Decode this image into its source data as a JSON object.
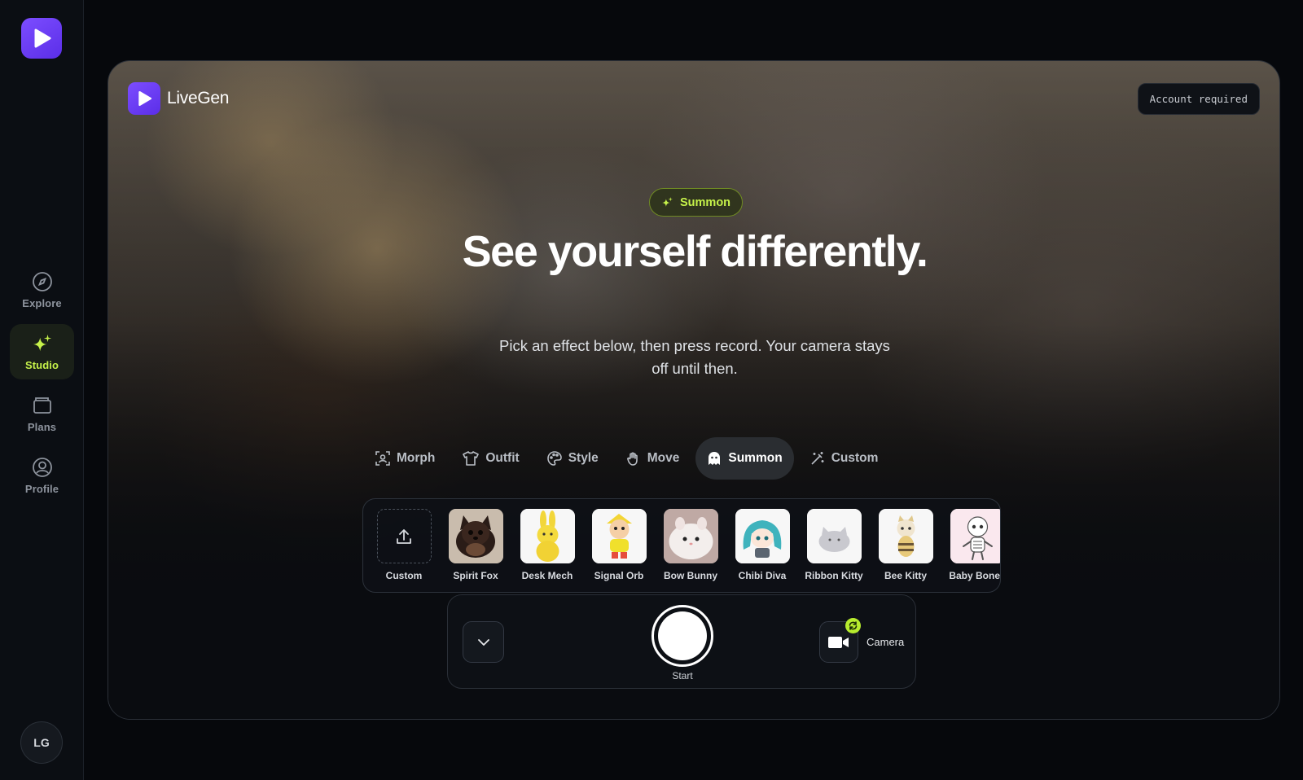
{
  "sidebar": {
    "logo_icon": "play-icon",
    "items": [
      {
        "label": "Explore",
        "icon": "compass-icon",
        "active": false
      },
      {
        "label": "Studio",
        "icon": "sparkle-icon",
        "active": true
      },
      {
        "label": "Plans",
        "icon": "wallet-icon",
        "active": false
      },
      {
        "label": "Profile",
        "icon": "user-circle-icon",
        "active": false
      }
    ],
    "avatar_initials": "LG"
  },
  "stage": {
    "brand": "LiveGen",
    "account_button": "Account required",
    "badge": "Summon",
    "headline": "See yourself differently.",
    "subline": "Pick an effect below, then press record. Your camera stays off until then."
  },
  "tabs": [
    {
      "label": "Morph",
      "icon": "face-scan-icon"
    },
    {
      "label": "Outfit",
      "icon": "shirt-icon"
    },
    {
      "label": "Style",
      "icon": "palette-icon"
    },
    {
      "label": "Move",
      "icon": "hand-icon"
    },
    {
      "label": "Summon",
      "icon": "ghost-icon",
      "active": true
    },
    {
      "label": "Custom",
      "icon": "wand-icon"
    }
  ],
  "effects": [
    {
      "label": "Custom",
      "icon": "upload-icon"
    },
    {
      "label": "Spirit Fox"
    },
    {
      "label": "Desk Mech"
    },
    {
      "label": "Signal Orb"
    },
    {
      "label": "Bow Bunny"
    },
    {
      "label": "Chibi Diva"
    },
    {
      "label": "Ribbon Kitty"
    },
    {
      "label": "Bee Kitty"
    },
    {
      "label": "Baby Bones"
    }
  ],
  "controls": {
    "start_label": "Start",
    "camera_label": "Camera"
  },
  "colors": {
    "accent_lime": "#c6f24a",
    "brand_purple": "#6a3cf5"
  }
}
